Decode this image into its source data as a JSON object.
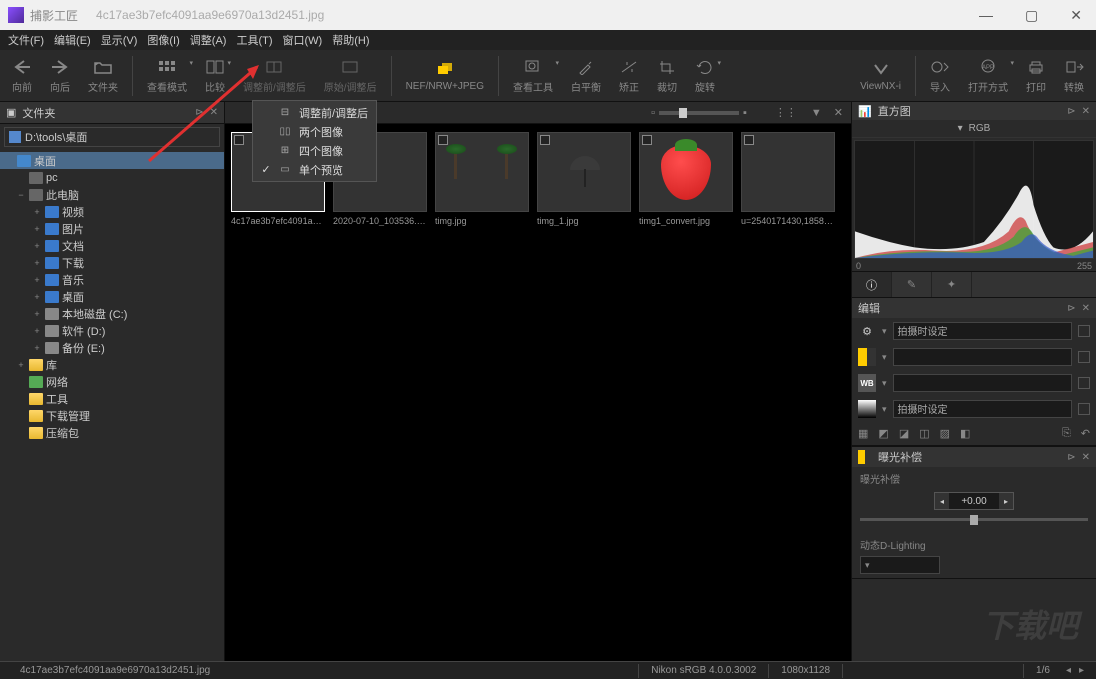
{
  "titlebar": {
    "app_name": "捕影工匠",
    "file_name": "4c17ae3b7efc4091aa9e6970a13d2451.jpg"
  },
  "menubar": {
    "items": [
      "文件(F)",
      "编辑(E)",
      "显示(V)",
      "图像(I)",
      "调整(A)",
      "工具(T)",
      "窗口(W)",
      "帮助(H)"
    ]
  },
  "toolbar": {
    "back": "向前",
    "forward": "向后",
    "folder": "文件夹",
    "view_mode": "查看模式",
    "compare": "比较",
    "before_after": "调整前/调整后",
    "original": "原始/调整后",
    "nef": "NEF/NRW+JPEG",
    "view_tool": "查看工具",
    "wb": "白平衡",
    "correct": "矫正",
    "crop": "裁切",
    "rotate": "旋转",
    "viewnx": "ViewNX-i",
    "import": "导入",
    "open_mode": "打开方式",
    "print": "打印",
    "export": "转换"
  },
  "sidebar": {
    "header": "文件夹",
    "path": "D:\\tools\\桌面",
    "tree": [
      {
        "label": "桌面",
        "level": 0,
        "exp": "",
        "icon": "desktop",
        "sel": true
      },
      {
        "label": "pc",
        "level": 1,
        "exp": "",
        "icon": "pc"
      },
      {
        "label": "此电脑",
        "level": 1,
        "exp": "−",
        "icon": "pc"
      },
      {
        "label": "视频",
        "level": 2,
        "exp": "+",
        "icon": "blue"
      },
      {
        "label": "图片",
        "level": 2,
        "exp": "+",
        "icon": "blue"
      },
      {
        "label": "文档",
        "level": 2,
        "exp": "+",
        "icon": "blue"
      },
      {
        "label": "下载",
        "level": 2,
        "exp": "+",
        "icon": "blue"
      },
      {
        "label": "音乐",
        "level": 2,
        "exp": "+",
        "icon": "blue"
      },
      {
        "label": "桌面",
        "level": 2,
        "exp": "+",
        "icon": "blue"
      },
      {
        "label": "本地磁盘 (C:)",
        "level": 2,
        "exp": "+",
        "icon": "disk"
      },
      {
        "label": "软件 (D:)",
        "level": 2,
        "exp": "+",
        "icon": "disk"
      },
      {
        "label": "备份 (E:)",
        "level": 2,
        "exp": "+",
        "icon": "disk"
      },
      {
        "label": "库",
        "level": 1,
        "exp": "+",
        "icon": "folder"
      },
      {
        "label": "网络",
        "level": 1,
        "exp": "",
        "icon": "net"
      },
      {
        "label": "工具",
        "level": 1,
        "exp": "",
        "icon": "folder"
      },
      {
        "label": "下载管理",
        "level": 1,
        "exp": "",
        "icon": "folder"
      },
      {
        "label": "压缩包",
        "level": 1,
        "exp": "",
        "icon": "folder"
      }
    ]
  },
  "dropdown": {
    "items": [
      {
        "label": "调整前/调整后",
        "checked": false,
        "icon": "⊟"
      },
      {
        "label": "两个图像",
        "checked": false,
        "icon": "▯▯"
      },
      {
        "label": "四个图像",
        "checked": false,
        "icon": "⊞"
      },
      {
        "label": "单个预览",
        "checked": true,
        "icon": "▭"
      }
    ]
  },
  "thumbs": [
    {
      "label": "4c17ae3b7efc4091aa9e69...",
      "cls": "img-text",
      "sel": true
    },
    {
      "label": "2020-07-10_103536.jpg",
      "cls": "img-art"
    },
    {
      "label": "timg.jpg",
      "cls": "img-beach1"
    },
    {
      "label": "timg_1.jpg",
      "cls": "img-beach2"
    },
    {
      "label": "timg1_convert.jpg",
      "cls": "img-strawberry"
    },
    {
      "label": "u=2540171430,18589162...",
      "cls": "img-anime"
    }
  ],
  "right": {
    "histogram_title": "直方图",
    "rgb_label": "RGB",
    "histo_min": "0",
    "histo_max": "255",
    "edit_title": "编辑",
    "shoot_setting": "拍摄时设定",
    "exposure_title": "曝光补偿",
    "exposure_label": "曝光补偿",
    "exposure_value": "+0.00",
    "dlighting_label": "动态D-Lighting"
  },
  "status": {
    "filename": "4c17ae3b7efc4091aa9e6970a13d2451.jpg",
    "profile": "Nikon sRGB 4.0.0.3002",
    "dims": "1080x1128",
    "page": "1/6"
  },
  "watermark": "下载吧"
}
